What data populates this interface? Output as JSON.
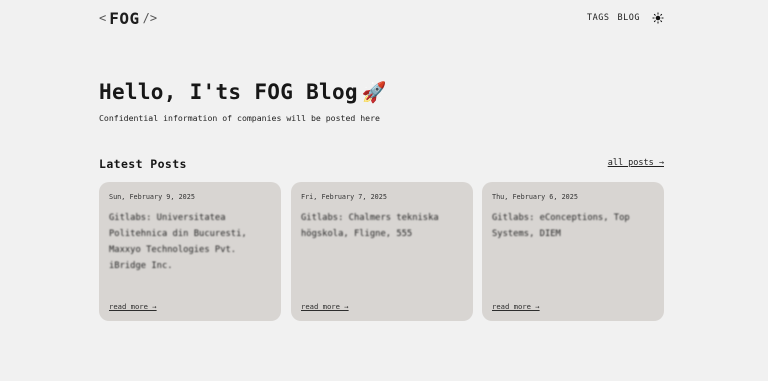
{
  "header": {
    "logo": {
      "left_bracket": "<",
      "text": "FOG",
      "right_bracket": "/>"
    },
    "nav": {
      "tags": "TAGS",
      "blog": "BLOG",
      "theme_icon": "sun-icon"
    }
  },
  "hero": {
    "title": "Hello, I'ts FOG Blog",
    "emoji": "🚀",
    "subtitle": "Confidential information of companies will be posted here"
  },
  "latest": {
    "title": "Latest Posts",
    "all_posts": "all posts →",
    "posts": [
      {
        "date": "Sun, February 9, 2025",
        "title": "Gitlabs: Universitatea Politehnica din Bucuresti, Maxxyo Technologies Pvt. iBridge Inc.",
        "read_more": "read more →"
      },
      {
        "date": "Fri, February 7, 2025",
        "title": "Gitlabs: Chalmers tekniska högskola, Fligne, 555",
        "read_more": "read more →"
      },
      {
        "date": "Thu, February 6, 2025",
        "title": "Gitlabs: eConceptions, Top Systems, DIEM",
        "read_more": "read more →"
      }
    ]
  },
  "colors": {
    "background": "#f1f1f1",
    "card": "#d8d5d2",
    "text": "#1f1f1f"
  }
}
